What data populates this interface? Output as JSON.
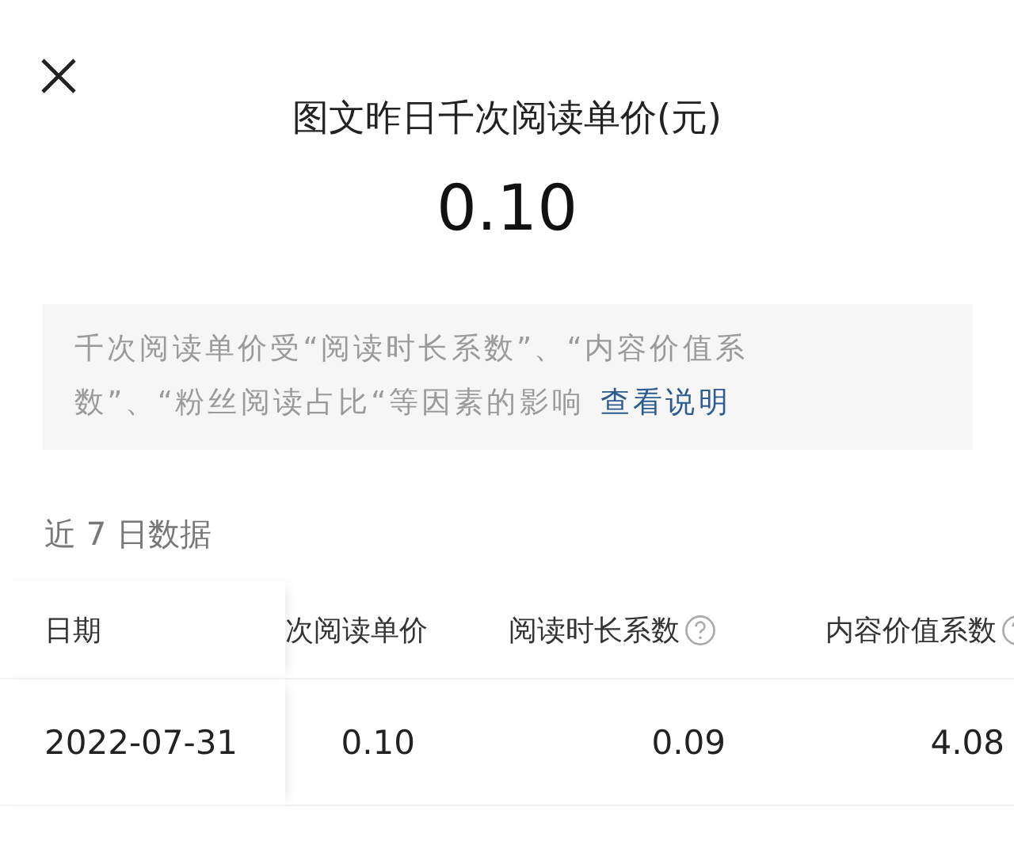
{
  "title": "图文昨日千次阅读单价(元)",
  "value": "0.10",
  "notice": {
    "text": "千次阅读单价受“阅读时长系数”、“内容价值系数”、“粉丝阅读占比“等因素的影响",
    "link": "查看说明"
  },
  "section_title": "近 7 日数据",
  "table": {
    "columns": [
      {
        "label": "日期",
        "help": false
      },
      {
        "label": "次阅读单价",
        "help": false
      },
      {
        "label": "阅读时长系数",
        "help": true
      },
      {
        "label": "内容价值系数",
        "help": true
      }
    ],
    "rows": [
      [
        "2022-07-31",
        "0.10",
        "0.09",
        "4.08"
      ]
    ]
  }
}
